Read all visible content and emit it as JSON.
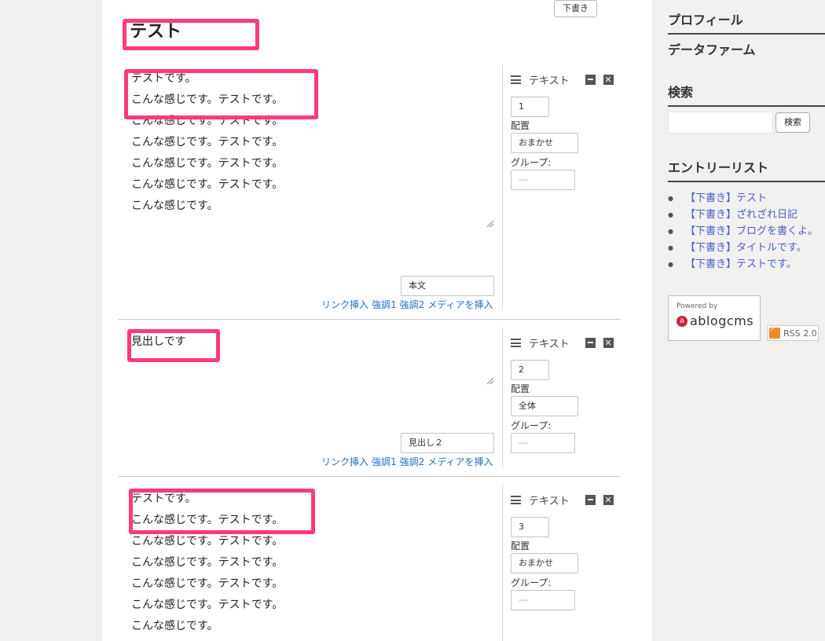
{
  "draft_button": "下書き",
  "title": "テスト",
  "units": [
    {
      "text": "テストです。\nこんな感じです。テストです。\nこんな感じです。テストです。\nこんな感じです。テストです。\nこんな感じです。テストです。\nこんな感じです。テストです。\nこんな感じです。",
      "type_label": "テキスト",
      "order": "1",
      "align_label": "配置",
      "align_value": "おまかせ",
      "group_label": "グループ:",
      "group_value": "---",
      "style_value": "本文",
      "links": [
        "リンク挿入",
        "強調1",
        "強調2",
        "メディアを挿入"
      ]
    },
    {
      "text": "見出しです",
      "type_label": "テキスト",
      "order": "2",
      "align_label": "配置",
      "align_value": "全体",
      "group_label": "グループ:",
      "group_value": "---",
      "style_value": "見出し２",
      "links": [
        "リンク挿入",
        "強調1",
        "強調2",
        "メディアを挿入"
      ]
    },
    {
      "text": "テストです。\nこんな感じです。テストです。\nこんな感じです。テストです。\nこんな感じです。テストです。\nこんな感じです。テストです。\nこんな感じです。テストです。\nこんな感じです。",
      "type_label": "テキスト",
      "order": "3",
      "align_label": "配置",
      "align_value": "おまかせ",
      "group_label": "グループ:",
      "group_value": "---"
    }
  ],
  "sidebar": {
    "profile": "プロフィール",
    "datafarm": "データファーム",
    "search_heading": "検索",
    "search_button": "検索",
    "entry_heading": "エントリーリスト",
    "entries": [
      "【下書き】テスト",
      "【下書き】ざれざれ日記",
      "【下書き】ブログを書くよ。",
      "【下書き】タイトルです。",
      "【下書き】テストです。"
    ],
    "powered_by": "Powered by",
    "brand": "ablogcms",
    "rss": "RSS 2.0"
  },
  "colors": {
    "highlight": "#ff3a77",
    "link": "#2a6ec1",
    "entry_link": "#4a5dc8"
  }
}
